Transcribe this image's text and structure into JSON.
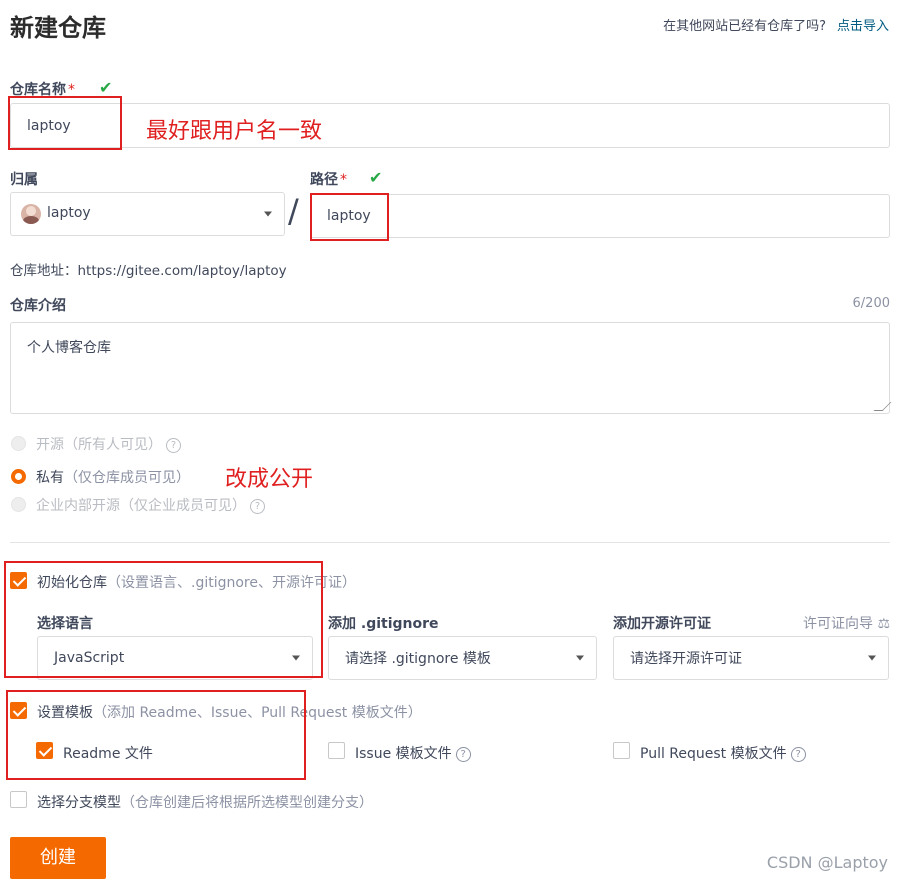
{
  "header": {
    "title": "新建仓库",
    "import_question": "在其他网站已经有仓库了吗?",
    "import_link": "点击导入"
  },
  "repo_name": {
    "label": "仓库名称",
    "required_mark": "*",
    "value": "laptoy",
    "annotation": "最好跟用户名一致"
  },
  "owner": {
    "label": "归属",
    "value": "laptoy",
    "separator": "/"
  },
  "path": {
    "label": "路径",
    "required_mark": "*",
    "value": "laptoy"
  },
  "repo_address": "仓库地址：https://gitee.com/laptoy/laptoy",
  "description": {
    "label": "仓库介绍",
    "counter": "6/200",
    "value": "个人博客仓库"
  },
  "visibility": {
    "options": [
      {
        "label": "开源",
        "hint": "（所有人可见）",
        "state": "disabled",
        "has_help": true
      },
      {
        "label": "私有",
        "hint": "（仅仓库成员可见）",
        "state": "selected",
        "has_help": false
      },
      {
        "label": "企业内部开源",
        "hint": "（仅企业成员可见）",
        "state": "disabled",
        "has_help": true
      }
    ],
    "annotation": "改成公开"
  },
  "init_repo": {
    "label": "初始化仓库",
    "hint": "（设置语言、.gitignore、开源许可证）",
    "checked": true,
    "language": {
      "label": "选择语言",
      "value": "JavaScript"
    },
    "gitignore": {
      "label": "添加 .gitignore",
      "value": "请选择 .gitignore 模板"
    },
    "license": {
      "label": "添加开源许可证",
      "guide": "许可证向导",
      "value": "请选择开源许可证"
    }
  },
  "templates": {
    "label": "设置模板",
    "hint": "（添加 Readme、Issue、Pull Request 模板文件）",
    "checked": true,
    "items": [
      {
        "label": "Readme 文件",
        "checked": true
      },
      {
        "label": "Issue 模板文件",
        "checked": false
      },
      {
        "label": "Pull Request 模板文件",
        "checked": false
      }
    ]
  },
  "branch_model": {
    "label": "选择分支模型",
    "hint": "（仓库创建后将根据所选模型创建分支）",
    "checked": false
  },
  "create_button": "创建",
  "watermark": "CSDN @Laptoy",
  "colors": {
    "accent": "#f56a00",
    "annotation": "#e02020",
    "check": "#28a745",
    "link": "#005980"
  }
}
